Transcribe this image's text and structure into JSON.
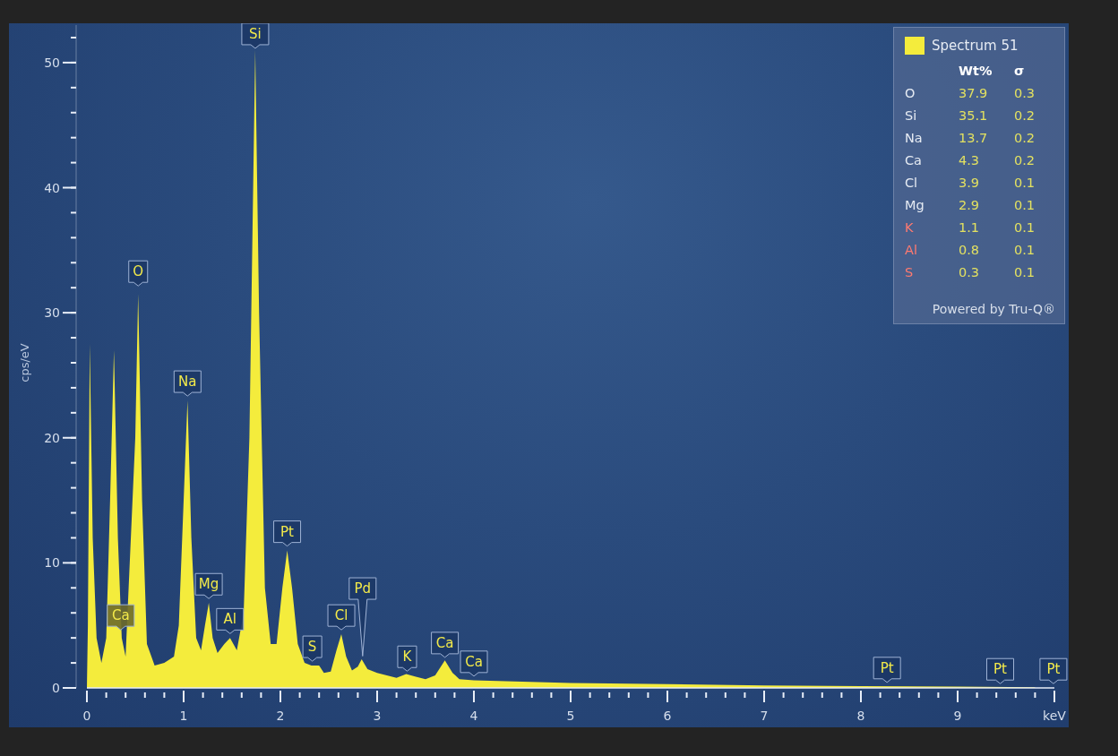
{
  "chart": {
    "chart_data": {
      "type": "area",
      "ylabel": "cps/eV",
      "xlim": [
        0,
        10
      ],
      "ylim": [
        0,
        53
      ],
      "xticks": [
        0,
        1,
        2,
        3,
        4,
        5,
        6,
        7,
        8,
        9,
        {
          "value": 10,
          "label": "keV"
        }
      ],
      "yticks": [
        0,
        10,
        20,
        30,
        40,
        50
      ],
      "x": [
        0,
        0.01,
        0.03,
        0.06,
        0.1,
        0.15,
        0.2,
        0.24,
        0.28,
        0.32,
        0.36,
        0.4,
        0.5,
        0.53,
        0.57,
        0.62,
        0.7,
        0.8,
        0.9,
        0.95,
        1.0,
        1.04,
        1.08,
        1.13,
        1.18,
        1.22,
        1.26,
        1.3,
        1.35,
        1.42,
        1.48,
        1.55,
        1.62,
        1.68,
        1.74,
        1.78,
        1.84,
        1.9,
        1.96,
        2.02,
        2.07,
        2.12,
        2.18,
        2.25,
        2.32,
        2.4,
        2.45,
        2.52,
        2.58,
        2.63,
        2.68,
        2.74,
        2.8,
        2.84,
        2.9,
        3.0,
        3.1,
        3.2,
        3.3,
        3.4,
        3.5,
        3.6,
        3.7,
        3.78,
        3.85,
        4.0,
        4.5,
        5,
        6,
        7,
        8,
        9,
        9.8
      ],
      "series": [
        {
          "name": "Spectrum 51",
          "color": "#f4ec3c",
          "values": [
            0,
            5,
            27.5,
            12,
            4,
            2,
            4,
            15,
            27,
            12,
            4,
            2.5,
            20,
            31.5,
            15,
            3.5,
            1.8,
            2,
            2.5,
            5,
            15,
            23,
            12,
            4,
            3,
            5,
            6.8,
            4,
            2.8,
            3.5,
            4,
            3,
            6,
            20,
            51,
            30,
            8,
            3.5,
            3.5,
            8,
            11,
            8,
            3.5,
            2,
            1.8,
            1.8,
            1.2,
            1.3,
            3,
            4.3,
            2.5,
            1.4,
            1.7,
            2.3,
            1.5,
            1.2,
            1,
            0.8,
            1.1,
            0.9,
            0.7,
            1,
            2.2,
            1.2,
            0.7,
            0.6,
            0.5,
            0.4,
            0.3,
            0.2,
            0.15,
            0.1,
            0.05
          ]
        }
      ]
    }
  },
  "peak_labels": [
    {
      "label": "Ca",
      "selected": true
    },
    {
      "label": "O",
      "selected": false
    },
    {
      "label": "Na",
      "selected": false
    },
    {
      "label": "Mg",
      "selected": false
    },
    {
      "label": "Al",
      "selected": false
    },
    {
      "label": "Si",
      "selected": false
    },
    {
      "label": "Pt",
      "selected": false
    },
    {
      "label": "S",
      "selected": false
    },
    {
      "label": "Cl",
      "selected": false
    },
    {
      "label": "Pd",
      "selected": false
    },
    {
      "label": "K",
      "selected": false
    },
    {
      "label": "Ca",
      "selected": false
    },
    {
      "label": "Ca",
      "selected": false
    },
    {
      "label": "Pt",
      "selected": false
    },
    {
      "label": "Pt",
      "selected": false
    },
    {
      "label": "Pt",
      "selected": false
    }
  ],
  "legend": {
    "columns": [
      "Wt%",
      "σ"
    ],
    "rows": [
      {
        "element": "O",
        "wt": "37.9",
        "sigma": "0.3",
        "flagged": false
      },
      {
        "element": "Si",
        "wt": "35.1",
        "sigma": "0.2",
        "flagged": false
      },
      {
        "element": "Na",
        "wt": "13.7",
        "sigma": "0.2",
        "flagged": false
      },
      {
        "element": "Ca",
        "wt": "4.3",
        "sigma": "0.2",
        "flagged": false
      },
      {
        "element": "Cl",
        "wt": "3.9",
        "sigma": "0.1",
        "flagged": false
      },
      {
        "element": "Mg",
        "wt": "2.9",
        "sigma": "0.1",
        "flagged": false
      },
      {
        "element": "K",
        "wt": "1.1",
        "sigma": "0.1",
        "flagged": true
      },
      {
        "element": "Al",
        "wt": "0.8",
        "sigma": "0.1",
        "flagged": true
      },
      {
        "element": "S",
        "wt": "0.3",
        "sigma": "0.1",
        "flagged": true
      }
    ],
    "footer": "Powered by Tru-Q®"
  }
}
